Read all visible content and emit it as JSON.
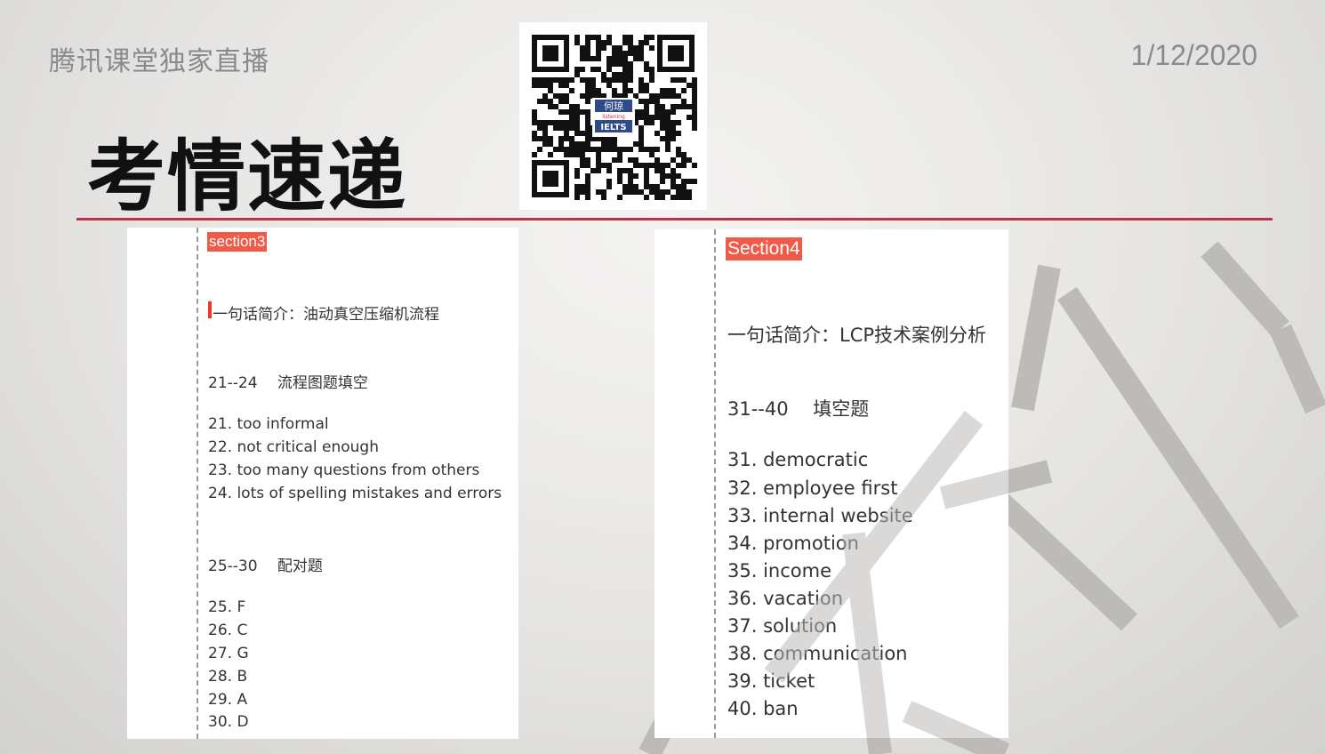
{
  "header": {
    "left_text": "腾讯课堂独家直播",
    "date": "1/12/2020"
  },
  "title": "考情速递",
  "qr": {
    "logo_line1": "何琼",
    "logo_line2": "listening",
    "logo_line3": "IELTS"
  },
  "section3": {
    "tag": "section3",
    "intro": "一句话简介：油动真空压缩机流程",
    "group1_header": "21--24　 流程图题填空",
    "group1_items": [
      "21. too informal",
      "22. not critical enough",
      "23. too many questions from others",
      "24. lots of spelling mistakes and errors"
    ],
    "group2_header": "25--30　 配对题",
    "group2_items": [
      "25. F",
      "26. C",
      "27. G",
      "28. B",
      "29. A",
      "30. D"
    ]
  },
  "section4": {
    "tag": "Section4",
    "intro": "一句话简介：LCP技术案例分析",
    "group_header": "31--40　 填空题",
    "items": [
      "31. democratic",
      "32. employee first",
      "33. internal website",
      "34. promotion",
      "35. income",
      "36. vacation",
      "37. solution",
      "38. communication",
      "39. ticket",
      "40. ban"
    ]
  },
  "colors": {
    "accent_line": "#b83446",
    "tag_bg": "#f05a48",
    "watermark": "#bdbbb9"
  }
}
